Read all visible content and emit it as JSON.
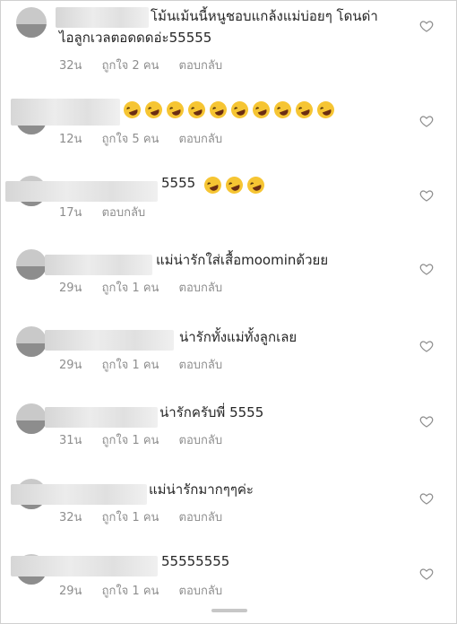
{
  "comments": [
    {
      "text": "โม้นเม้นนี้หนูชอบแกล้งแม่บ่อยๆ โดนด่า",
      "text2": "ไอลูกเวลตอดดดอ่ะ55555",
      "time": "32น",
      "likes": "ถูกใจ 2 คน",
      "reply": "ตอบกลับ"
    },
    {
      "text": "",
      "emoji_count": 10,
      "emoji_name": "rolling-on-floor-laughing-emoji",
      "time": "12น",
      "likes": "ถูกใจ 5 คน",
      "reply": "ตอบกลับ"
    },
    {
      "text": "5555",
      "emoji_count": 3,
      "emoji_name": "rolling-on-floor-laughing-emoji",
      "time": "17น",
      "likes": "",
      "reply": "ตอบกลับ"
    },
    {
      "text": "แม่น่ารักใส่เสื้อmoominด้วยย",
      "time": "29น",
      "likes": "ถูกใจ 1 คน",
      "reply": "ตอบกลับ"
    },
    {
      "text": "น่ารักทั้งแม่ทั้งลูกเลย",
      "time": "29น",
      "likes": "ถูกใจ 1 คน",
      "reply": "ตอบกลับ"
    },
    {
      "text": "น่ารักครับพี่ 5555",
      "time": "31น",
      "likes": "ถูกใจ 1 คน",
      "reply": "ตอบกลับ"
    },
    {
      "text": "แม่น่ารักมากๆๆค่ะ",
      "time": "32น",
      "likes": "ถูกใจ 1 คน",
      "reply": "ตอบกลับ"
    },
    {
      "text": "55555555",
      "time": "29น",
      "likes": "ถูกใจ 1 คน",
      "reply": "ตอบกลับ"
    }
  ],
  "icons": {
    "like": "heart-outline-icon"
  },
  "colors": {
    "text": "#262626",
    "meta": "#8e8e8e",
    "background": "#ffffff"
  }
}
